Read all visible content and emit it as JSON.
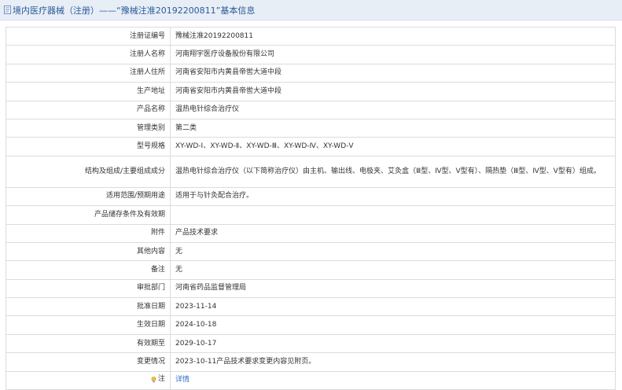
{
  "header": {
    "title": "境内医疗器械（注册）——“豫械注准20192200811”基本信息"
  },
  "rows": [
    {
      "label": "注册证编号",
      "value": "豫械注准20192200811"
    },
    {
      "label": "注册人名称",
      "value": "河南翔宇医疗设备股份有限公司"
    },
    {
      "label": "注册人住所",
      "value": "河南省安阳市内黄县帝喾大道中段"
    },
    {
      "label": "生产地址",
      "value": "河南省安阳市内黄县帝喾大道中段"
    },
    {
      "label": "产品名称",
      "value": "温热电针综合治疗仪"
    },
    {
      "label": "管理类别",
      "value": "第二类"
    },
    {
      "label": "型号规格",
      "value": "XY-WD-Ⅰ、XY-WD-Ⅱ、XY-WD-Ⅲ、XY-WD-Ⅳ、XY-WD-Ⅴ"
    },
    {
      "label": "结构及组成/主要组成成分",
      "value": "温热电针综合治疗仪（以下简称治疗仪）由主机、输出线、电极夹、艾灸盒（Ⅲ型、Ⅳ型、Ⅴ型有）、隔热垫（Ⅲ型、Ⅳ型、Ⅴ型有）组成。"
    },
    {
      "label": "适用范围/预期用途",
      "value": "适用于与针灸配合治疗。"
    },
    {
      "label": "产品储存条件及有效期",
      "value": ""
    },
    {
      "label": "附件",
      "value": "产品技术要求"
    },
    {
      "label": "其他内容",
      "value": "无"
    },
    {
      "label": "备注",
      "value": "无"
    },
    {
      "label": "审批部门",
      "value": "河南省药品监督管理局"
    },
    {
      "label": "批准日期",
      "value": "2023-11-14"
    },
    {
      "label": "生效日期",
      "value": "2024-10-18"
    },
    {
      "label": "有效期至",
      "value": "2029-10-17"
    },
    {
      "label": "变更情况",
      "value": "2023-10-11产品技术要求变更内容见附页。"
    }
  ],
  "note": {
    "label": "注",
    "link_text": "详情",
    "icon": "lightbulb-icon"
  },
  "colors": {
    "header_bg": "#e8eef6",
    "header_text": "#2a5a9a",
    "link": "#2a6ecb",
    "border": "#dcdcdc"
  }
}
